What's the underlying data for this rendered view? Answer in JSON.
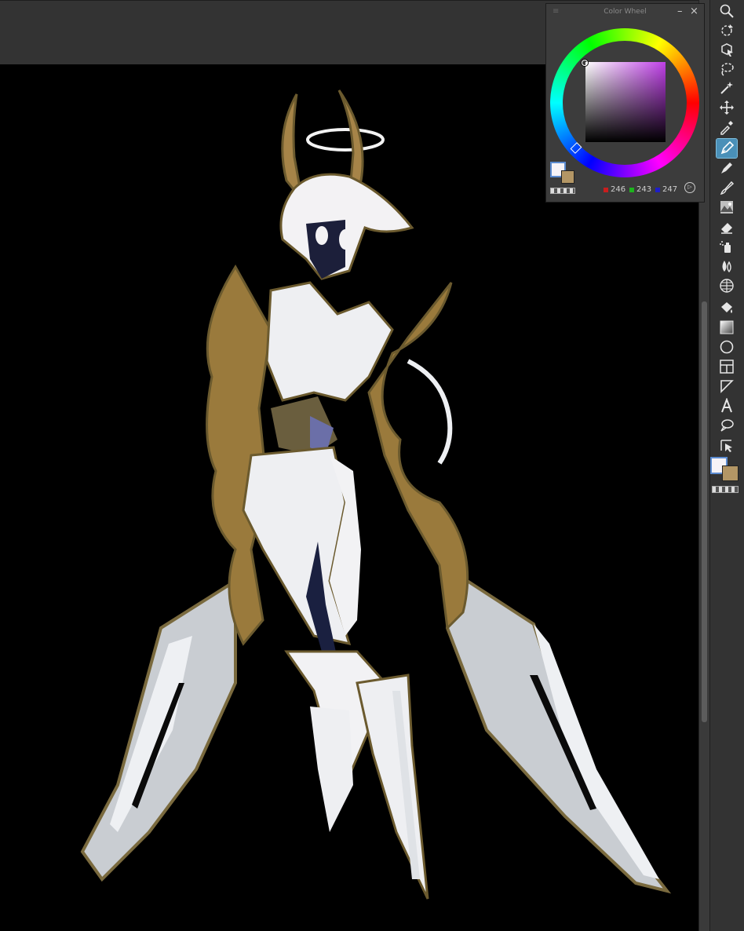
{
  "color_wheel": {
    "title": "Color Wheel",
    "minimize_label": "–",
    "close_label": "×",
    "grip_label": "≡",
    "rgb": {
      "r": "246",
      "g": "243",
      "b": "247"
    },
    "main_color": "#f6f3f7",
    "sub_color": "#b39665"
  },
  "toolbar": {
    "tools": [
      "zoom",
      "rotate",
      "object",
      "lasso",
      "auto-select",
      "move",
      "eyedropper",
      "pen",
      "marker",
      "brush",
      "decoration",
      "eraser",
      "airbrush",
      "blend",
      "figure-frame",
      "fill",
      "gradient",
      "ellipse",
      "frame-border",
      "ruler",
      "text",
      "balloon",
      "correct-line"
    ],
    "active_tool": "pen"
  },
  "icons": {
    "play": "▷"
  }
}
